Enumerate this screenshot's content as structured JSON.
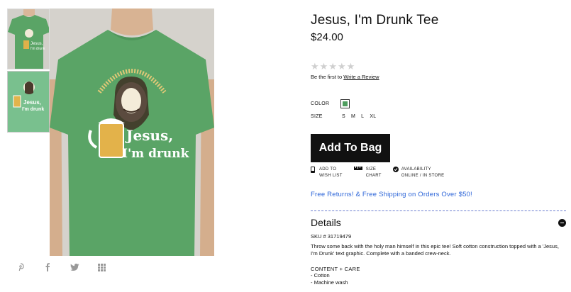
{
  "product": {
    "title": "Jesus, I'm Drunk Tee",
    "price": "$24.00",
    "rating_stars": 0,
    "review_prefix": "Be the first to ",
    "review_link": "Write a Review",
    "color_label": "COLOR",
    "color_swatch": "#4e9d5e",
    "size_label": "SIZE",
    "sizes": [
      "S",
      "M",
      "L",
      "XL"
    ],
    "add_to_bag": "Add To Bag",
    "actions": [
      {
        "icon": "phone-icon",
        "line1": "ADD TO",
        "line2": "WISH LIST"
      },
      {
        "icon": "ruler-icon",
        "line1": "SIZE",
        "line2": "CHART"
      },
      {
        "icon": "check-circle-icon",
        "line1": "AVAILABILITY",
        "line2": "ONLINE / IN STORE"
      }
    ],
    "promo": "Free Returns! & Free Shipping on Orders Over $50!",
    "details_title": "Details",
    "sku": "SKU # 31719479",
    "description": "Throw some back with the holy man himself in this epic tee! Soft cotton construction topped with a 'Jesus, I'm Drunk' text graphic. Complete with a banded crew-neck.",
    "content_care_label": "CONTENT + CARE",
    "content_care": [
      "- Cotton",
      "- Machine wash"
    ]
  },
  "graphic": {
    "line1": "Jesus,",
    "line2": "I'm drunk"
  },
  "share_icons": [
    "pinterest-icon",
    "facebook-icon",
    "twitter-icon",
    "grid-icon"
  ],
  "colors": {
    "shirt": "#5aa466",
    "promo_link": "#2b64d8",
    "button_bg": "#111111"
  }
}
